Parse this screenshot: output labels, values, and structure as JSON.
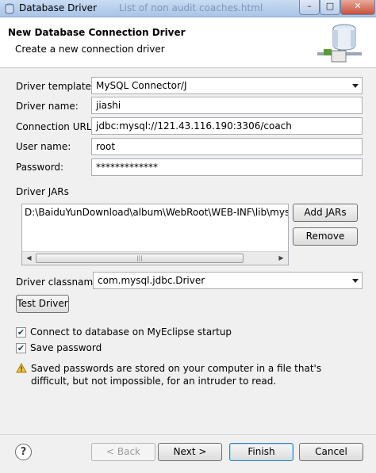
{
  "window": {
    "title": "Database Driver",
    "background_title": "List of non audit coaches.html"
  },
  "header": {
    "title": "New Database Connection Driver",
    "subtitle": "Create a new connection driver"
  },
  "form": {
    "driver_template": {
      "label": "Driver template:",
      "value": "MySQL Connector/J"
    },
    "driver_name": {
      "label": "Driver name:",
      "value": "jiashi"
    },
    "connection_url": {
      "label": "Connection URL:",
      "value": "jdbc:mysql://121.43.116.190:3306/coach"
    },
    "user_name": {
      "label": "User name:",
      "value": "root"
    },
    "password": {
      "label": "Password:",
      "value": "*************"
    }
  },
  "jars": {
    "label": "Driver JARs",
    "items": [
      "D:\\BaiduYunDownload\\album\\WebRoot\\WEB-INF\\lib\\mysql-connector-java.jar"
    ],
    "add_label": "Add JARs",
    "remove_label": "Remove"
  },
  "classname": {
    "label": "Driver classname:",
    "value": "com.mysql.jdbc.Driver"
  },
  "test_driver_label": "Test Driver",
  "options": {
    "connect_on_startup": {
      "label": "Connect to database on MyEclipse startup",
      "checked": true
    },
    "save_password": {
      "label": "Save password",
      "checked": true
    }
  },
  "warning": "Saved passwords are stored on your computer in a file that's difficult, but not impossible, for an intruder to read.",
  "buttons": {
    "back": "< Back",
    "next": "Next >",
    "finish": "Finish",
    "cancel": "Cancel"
  },
  "help_glyph": "?",
  "icons": {
    "app": "database-driver-icon",
    "banner": "database-icon",
    "warning": "warning-icon",
    "help": "help-icon"
  }
}
